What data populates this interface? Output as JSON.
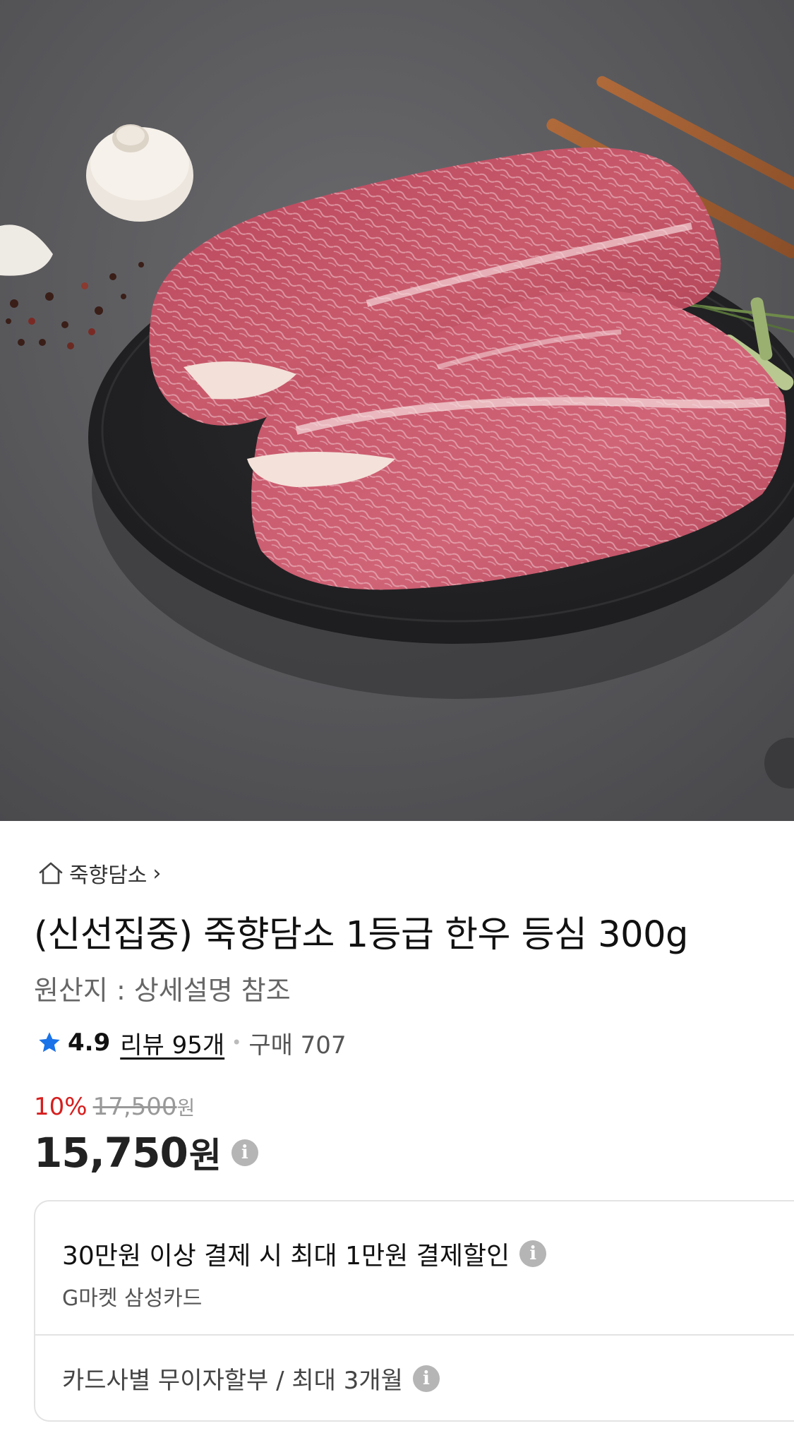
{
  "product": {
    "shop_name": "죽향담소",
    "title": "(신선집중) 죽향담소 1등급 한우 등심 300g",
    "origin": "원산지 : 상세설명 참조",
    "rating": "4.9",
    "reviews": "리뷰 95개",
    "purchases": "구매 707",
    "discount_rate": "10%",
    "original_price": "17,500",
    "original_price_unit": "원",
    "price": "15,750",
    "price_unit": "원"
  },
  "benefits": {
    "card_discount_title": "30만원 이상 결제 시 최대 1만원 결제할인",
    "card_discount_sub": "G마켓 삼성카드",
    "installment": "카드사별 무이자할부 / 최대 3개월"
  },
  "icons": {
    "home": "home-icon",
    "chevron": "chevron-right-icon",
    "star": "star-icon",
    "info": "info-icon"
  },
  "colors": {
    "discount": "#d71e1e",
    "star": "#1a73e8",
    "info_icon": "#b5b5b5"
  }
}
